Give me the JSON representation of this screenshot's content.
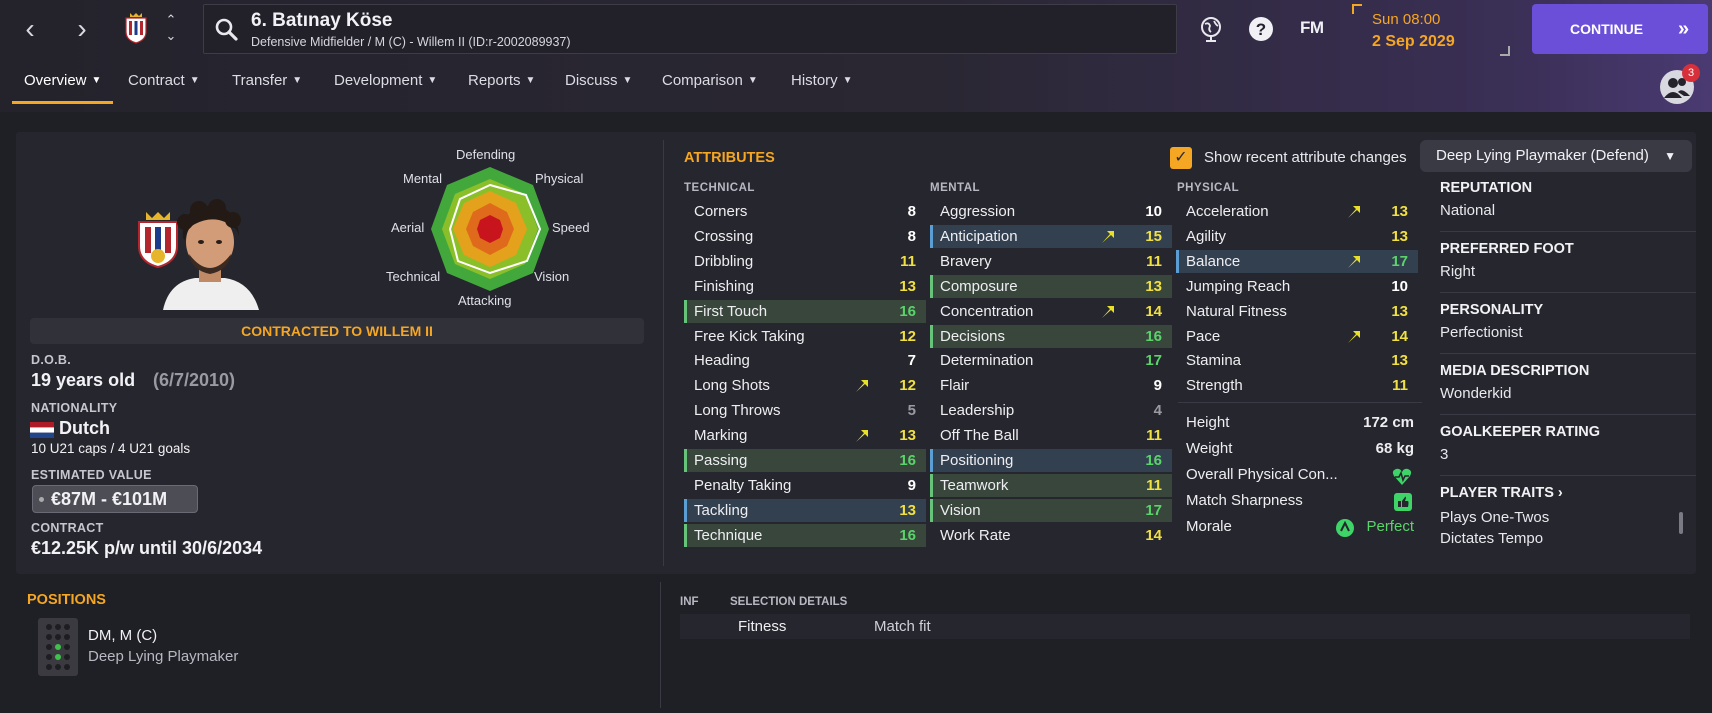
{
  "header": {
    "player_name": "6. Batınay Köse",
    "player_subtitle": "Defensive Midfielder / M (C) - Willem II (ID:r-2002089937)",
    "fm_logo": "FM",
    "time": "Sun 08:00",
    "date": "2 Sep 2029",
    "continue_label": "CONTINUE",
    "social_badge_count": "3"
  },
  "tabs": [
    {
      "label": "Overview",
      "active": true
    },
    {
      "label": "Contract"
    },
    {
      "label": "Transfer"
    },
    {
      "label": "Development"
    },
    {
      "label": "Reports"
    },
    {
      "label": "Discuss"
    },
    {
      "label": "Comparison"
    },
    {
      "label": "History"
    }
  ],
  "radar": {
    "labels": {
      "top": "Defending",
      "upper_left": "Mental",
      "upper_right": "Physical",
      "left": "Aerial",
      "right": "Speed",
      "lower_left": "Technical",
      "lower_right": "Vision",
      "bottom": "Attacking"
    }
  },
  "profile": {
    "contract_banner": "CONTRACTED TO WILLEM II",
    "dob_label": "D.O.B.",
    "age": "19 years old",
    "dob": "(6/7/2010)",
    "nationality_label": "NATIONALITY",
    "nationality": "Dutch",
    "caps": "10 U21 caps / 4 U21 goals",
    "value_label": "ESTIMATED VALUE",
    "value": "€87M - €101M",
    "contract_label": "CONTRACT",
    "contract": "€12.25K p/w until 30/6/2034"
  },
  "attributes": {
    "title": "ATTRIBUTES",
    "show_changes_label": "Show recent attribute changes",
    "show_changes_checked": true,
    "role": "Deep Lying Playmaker (Defend)",
    "technical_header": "TECHNICAL",
    "mental_header": "MENTAL",
    "physical_header": "PHYSICAL",
    "technical": [
      {
        "name": "Corners",
        "value": "8",
        "color": "#ffffff"
      },
      {
        "name": "Crossing",
        "value": "8",
        "color": "#ffffff"
      },
      {
        "name": "Dribbling",
        "value": "11",
        "color": "#f0e040"
      },
      {
        "name": "Finishing",
        "value": "13",
        "color": "#f0e040"
      },
      {
        "name": "First Touch",
        "value": "16",
        "color": "#5ad46a",
        "hl": "green"
      },
      {
        "name": "Free Kick Taking",
        "value": "12",
        "color": "#f0e040"
      },
      {
        "name": "Heading",
        "value": "7",
        "color": "#ffffff"
      },
      {
        "name": "Long Shots",
        "value": "12",
        "color": "#f0e040",
        "arrow": true
      },
      {
        "name": "Long Throws",
        "value": "5",
        "color": "#9a9aa2"
      },
      {
        "name": "Marking",
        "value": "13",
        "color": "#f0e040",
        "arrow": true
      },
      {
        "name": "Passing",
        "value": "16",
        "color": "#5ad46a",
        "hl": "green"
      },
      {
        "name": "Penalty Taking",
        "value": "9",
        "color": "#ffffff"
      },
      {
        "name": "Tackling",
        "value": "13",
        "color": "#f0e040",
        "hl": "blue"
      },
      {
        "name": "Technique",
        "value": "16",
        "color": "#5ad46a",
        "hl": "green"
      }
    ],
    "mental": [
      {
        "name": "Aggression",
        "value": "10",
        "color": "#ffffff"
      },
      {
        "name": "Anticipation",
        "value": "15",
        "color": "#f0e040",
        "hl": "blue",
        "arrow": true
      },
      {
        "name": "Bravery",
        "value": "11",
        "color": "#f0e040"
      },
      {
        "name": "Composure",
        "value": "13",
        "color": "#f0e040",
        "hl": "green"
      },
      {
        "name": "Concentration",
        "value": "14",
        "color": "#f0e040",
        "arrow": true
      },
      {
        "name": "Decisions",
        "value": "16",
        "color": "#5ad46a",
        "hl": "green"
      },
      {
        "name": "Determination",
        "value": "17",
        "color": "#5ad46a"
      },
      {
        "name": "Flair",
        "value": "9",
        "color": "#ffffff"
      },
      {
        "name": "Leadership",
        "value": "4",
        "color": "#9a9aa2"
      },
      {
        "name": "Off The Ball",
        "value": "11",
        "color": "#f0e040"
      },
      {
        "name": "Positioning",
        "value": "16",
        "color": "#5ad46a",
        "hl": "blue"
      },
      {
        "name": "Teamwork",
        "value": "11",
        "color": "#f0e040",
        "hl": "green"
      },
      {
        "name": "Vision",
        "value": "17",
        "color": "#5ad46a",
        "hl": "green"
      },
      {
        "name": "Work Rate",
        "value": "14",
        "color": "#f0e040"
      }
    ],
    "physical": [
      {
        "name": "Acceleration",
        "value": "13",
        "color": "#f0e040",
        "arrow": true
      },
      {
        "name": "Agility",
        "value": "13",
        "color": "#f0e040"
      },
      {
        "name": "Balance",
        "value": "17",
        "color": "#5ad46a",
        "hl": "blue",
        "arrow": true
      },
      {
        "name": "Jumping Reach",
        "value": "10",
        "color": "#ffffff"
      },
      {
        "name": "Natural Fitness",
        "value": "13",
        "color": "#f0e040"
      },
      {
        "name": "Pace",
        "value": "14",
        "color": "#f0e040",
        "arrow": true
      },
      {
        "name": "Stamina",
        "value": "13",
        "color": "#f0e040"
      },
      {
        "name": "Strength",
        "value": "11",
        "color": "#f0e040"
      }
    ]
  },
  "physical_info": {
    "height_label": "Height",
    "height": "172 cm",
    "weight_label": "Weight",
    "weight": "68 kg",
    "condition_label": "Overall Physical Con...",
    "sharpness_label": "Match Sharpness",
    "morale_label": "Morale",
    "morale": "Perfect"
  },
  "bio": {
    "reputation_label": "REPUTATION",
    "reputation": "National",
    "foot_label": "PREFERRED FOOT",
    "foot": "Right",
    "personality_label": "PERSONALITY",
    "personality": "Perfectionist",
    "media_label": "MEDIA DESCRIPTION",
    "media": "Wonderkid",
    "gk_label": "GOALKEEPER RATING",
    "gk": "3",
    "traits_label": "PLAYER TRAITS",
    "traits": [
      "Plays One-Twos",
      "Dictates Tempo"
    ]
  },
  "positions": {
    "title": "POSITIONS",
    "positions_text": "DM, M (C)",
    "role_text": "Deep Lying Playmaker"
  },
  "selection": {
    "inf_header": "INF",
    "details_header": "SELECTION DETAILS",
    "rows": [
      {
        "label": "Fitness",
        "value": "Match fit"
      }
    ]
  },
  "colors": {
    "accent": "#f5a623",
    "continue": "#6b4fd8",
    "green_value": "#5ad46a",
    "yellow_value": "#f0e040"
  }
}
